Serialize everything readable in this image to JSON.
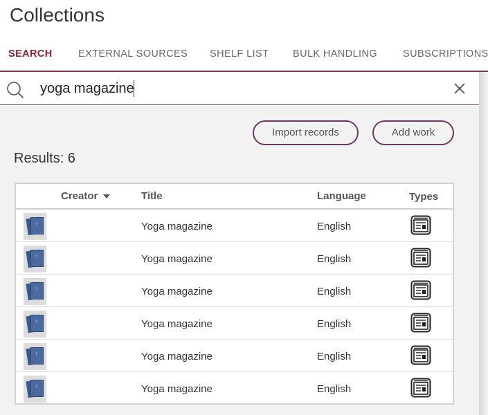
{
  "app": {
    "title": "Collections"
  },
  "tabs": [
    {
      "label": "SEARCH",
      "active": true
    },
    {
      "label": "EXTERNAL SOURCES",
      "active": false
    },
    {
      "label": "SHELF LIST",
      "active": false
    },
    {
      "label": "BULK HANDLING",
      "active": false
    },
    {
      "label": "SUBSCRIPTIONS",
      "active": false
    }
  ],
  "search": {
    "value": "yoga magazine",
    "icon": "search-icon",
    "clear_icon": "close-icon"
  },
  "actions": {
    "import_label": "Import records",
    "add_label": "Add work"
  },
  "results": {
    "label": "Results: 6",
    "count": 6
  },
  "table": {
    "columns": {
      "creator": "Creator",
      "title": "Title",
      "language": "Language",
      "types": "Types"
    },
    "sort": {
      "column": "creator",
      "direction": "descending"
    },
    "rows": [
      {
        "cover_icon": "magazine-cover-icon",
        "creator": "",
        "title": "Yoga magazine",
        "language": "English",
        "type_icon": "periodical-icon"
      },
      {
        "cover_icon": "magazine-cover-icon",
        "creator": "",
        "title": "Yoga magazine",
        "language": "English",
        "type_icon": "periodical-icon"
      },
      {
        "cover_icon": "magazine-cover-icon",
        "creator": "",
        "title": "Yoga magazine",
        "language": "English",
        "type_icon": "periodical-icon"
      },
      {
        "cover_icon": "magazine-cover-icon",
        "creator": "",
        "title": "Yoga magazine",
        "language": "English",
        "type_icon": "periodical-icon"
      },
      {
        "cover_icon": "magazine-cover-icon",
        "creator": "",
        "title": "Yoga magazine",
        "language": "English",
        "type_icon": "periodical-icon"
      },
      {
        "cover_icon": "magazine-cover-icon",
        "creator": "",
        "title": "Yoga magazine",
        "language": "English",
        "type_icon": "periodical-icon"
      }
    ]
  },
  "colors": {
    "accent": "#8b2232",
    "button_border": "#6b3a5a",
    "panel_bg": "#f2f2f2"
  }
}
